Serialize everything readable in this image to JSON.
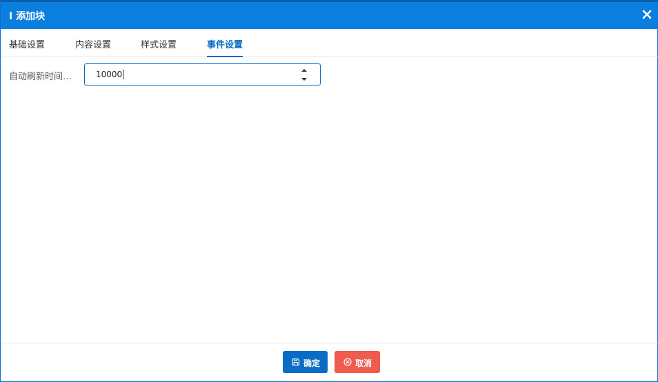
{
  "dialog": {
    "title": "Ι 添加块",
    "close_icon": "close-icon"
  },
  "tabs": [
    {
      "label": "基础设置",
      "active": false
    },
    {
      "label": "内容设置",
      "active": false
    },
    {
      "label": "样式设置",
      "active": false
    },
    {
      "label": "事件设置",
      "active": true
    }
  ],
  "form": {
    "refresh_label": "自动刷新时间…",
    "refresh_value": "10000",
    "spinner_up_icon": "caret-up-icon",
    "spinner_down_icon": "caret-down-icon"
  },
  "footer": {
    "ok_label": "确定",
    "ok_icon": "save-icon",
    "cancel_label": "取消",
    "cancel_icon": "circle-x-icon"
  },
  "colors": {
    "titlebar": "#0a7fe0",
    "accent": "#0a6cc4",
    "cancel": "#ef5b4f"
  }
}
